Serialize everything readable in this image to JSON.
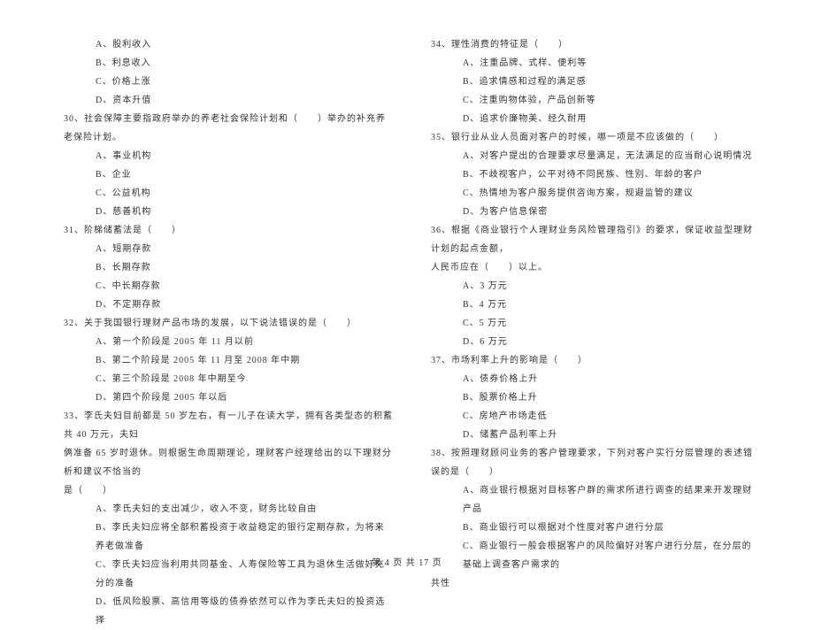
{
  "left_column": {
    "pre_options": [
      "A、股利收入",
      "B、利息收入",
      "C、价格上涨",
      "D、资本升值"
    ],
    "questions": [
      {
        "num": "30",
        "text": "、社会保障主要指政府举办的养老社会保险计划和（　　）举办的补充养老保险计划。",
        "options": [
          "A、事业机构",
          "B、企业",
          "C、公益机构",
          "D、慈善机构"
        ]
      },
      {
        "num": "31",
        "text": "、阶梯储蓄法是（　　）",
        "options": [
          "A、短期存款",
          "B、长期存款",
          "C、中长期存款",
          "D、不定期存款"
        ]
      },
      {
        "num": "32",
        "text": "、关于我国银行理财产品市场的发展，以下说法错误的是（　　）",
        "options": [
          "A、第一个阶段是 2005 年 11 月以前",
          "B、第二个阶段是 2005 年 11 月至 2008 年中期",
          "C、第三个阶段是 2008 年中期至今",
          "D、第四个阶段是 2005 年以后"
        ]
      },
      {
        "num": "33",
        "text": "、李氏夫妇目前都是 50 岁左右，有一儿子在读大学，拥有各类型态的积蓄共 40 万元，夫妇",
        "continuation": [
          "俩准备 65 岁时退休。则根据生命周期理论，理财客户经理给出的以下理财分析和建议不恰当的",
          "是（　　）"
        ],
        "options": [
          "A、李氏夫妇的支出减少，收入不变，财务比较自由",
          "B、李氏夫妇应将全部积蓄投资于收益稳定的银行定期存款，为将来养老做准备",
          "C、李氏夫妇应当利用共同基金、人寿保险等工具为退休生活做好充分的准备",
          "D、低风险股票、高信用等级的债券依然可以作为李氏夫妇的投资选择"
        ]
      }
    ]
  },
  "right_column": {
    "questions": [
      {
        "num": "34",
        "text": "、理性消费的特征是（　　）",
        "options": [
          "A、注重品牌、式样、便利等",
          "B、追求情感和过程的满足感",
          "C、注重购物体验，产品创新等",
          "D、追求价廉物美、经久耐用"
        ]
      },
      {
        "num": "35",
        "text": "、银行业从业人员面对客户的时候，哪一项是不应该做的（　　）",
        "options": [
          "A、对客户提出的合理要求尽量满足，无法满足的应当耐心说明情况",
          "B、不歧视客户，公平对待不同民族、性别、年龄的客户",
          "C、热情地为客户服务提供咨询方案，规避监管的建议",
          "D、为客户信息保密"
        ]
      },
      {
        "num": "36",
        "text": "、根据《商业银行个人理财业务风险管理指引》的要求，保证收益型理财计划的起点金额，",
        "continuation": [
          "人民币应在（　　）以上。"
        ],
        "options": [
          "A、3 万元",
          "B、4 万元",
          "C、5 万元",
          "D、6 万元"
        ]
      },
      {
        "num": "37",
        "text": "、市场利率上升的影响是（　　）",
        "options": [
          "A、债券价格上升",
          "B、股票价格上升",
          "C、房地产市场走低",
          "D、储蓄产品利率上升"
        ]
      },
      {
        "num": "38",
        "text": "、按照理财顾问业务的客户管理要求，下列对客户实行分层管理的表述错误的是（　　）",
        "options": [
          "A、商业银行根据对目标客户群的需求所进行调查的结果来开发理财产品",
          "B、商业银行可以根据对个性度对客户进行分层",
          "C、商业银行一般会根据客户的风险偏好对客户进行分层，在分层的基础上调查客户需求的"
        ],
        "tail": "共性"
      }
    ]
  },
  "footer": {
    "text": "第 4 页 共 17 页"
  }
}
